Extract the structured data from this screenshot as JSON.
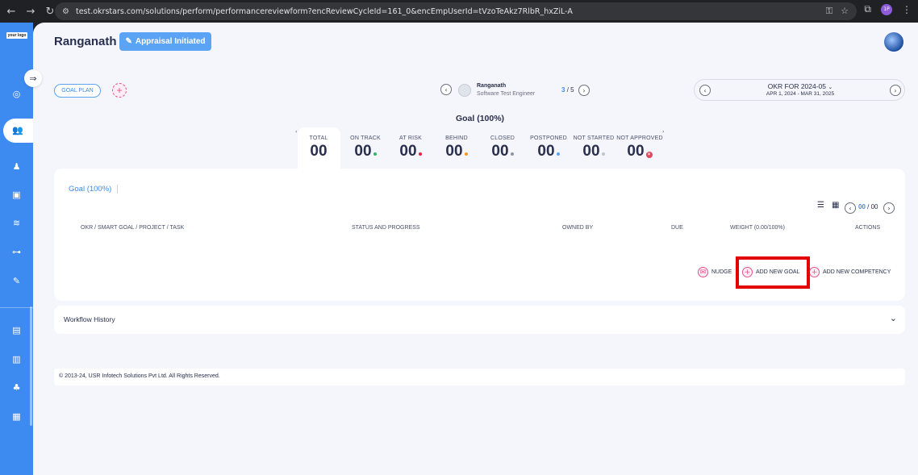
{
  "browser": {
    "url": "test.okrstars.com/solutions/perform/performancereviewform?encReviewCycleId=161_0&encEmpUserId=tVzoTeAkz7RlbR_hxZiL-A",
    "profile_initials": "1P"
  },
  "sidebar": {
    "logo_text": "your logo"
  },
  "header": {
    "employee_name": "Ranganath",
    "status_label": "Appraisal Initiated",
    "goal_plan_label": "GOAL PLAN"
  },
  "employee_nav": {
    "name": "Ranganath",
    "role": "Software Test Engineer",
    "current": "3",
    "separator": "/",
    "total": "5"
  },
  "cycle": {
    "title": "OKR FOR 2024-05",
    "range": "APR 1, 2024 - MAR 31, 2025"
  },
  "goal_heading": "Goal (100%)",
  "stats": [
    {
      "label": "TOTAL",
      "value": "00"
    },
    {
      "label": "ON TRACK",
      "value": "00",
      "color": "#2fb36b"
    },
    {
      "label": "AT RISK",
      "value": "00",
      "color": "#e0233e"
    },
    {
      "label": "BEHIND",
      "value": "00",
      "color": "#f29a1f"
    },
    {
      "label": "CLOSED",
      "value": "00",
      "color": "#8e93a6"
    },
    {
      "label": "POSTPONED",
      "value": "00",
      "color": "#5ba3f5"
    },
    {
      "label": "NOT STARTED",
      "value": "00",
      "color": "#c0c4cf"
    },
    {
      "label": "NOT APPROVED",
      "value": "00",
      "color": "#e0495a"
    }
  ],
  "card": {
    "tab_label": "Goal (100%)",
    "pager_current": "00",
    "pager_separator": "/",
    "pager_total": "00",
    "columns": [
      "OKR / SMART GOAL / PROJECT / TASK",
      "STATUS AND PROGRESS",
      "OWNED BY",
      "DUE",
      "WEIGHT (0.00/100%)",
      "ACTIONS"
    ],
    "actions": {
      "nudge": "NUDGE",
      "add_goal": "ADD NEW GOAL",
      "add_competency": "ADD NEW COMPETENCY"
    }
  },
  "workflow_history": "Workflow History",
  "footer": "© 2013-24, USR Infotech Solutions Pvt Ltd. All Rights Reserved."
}
